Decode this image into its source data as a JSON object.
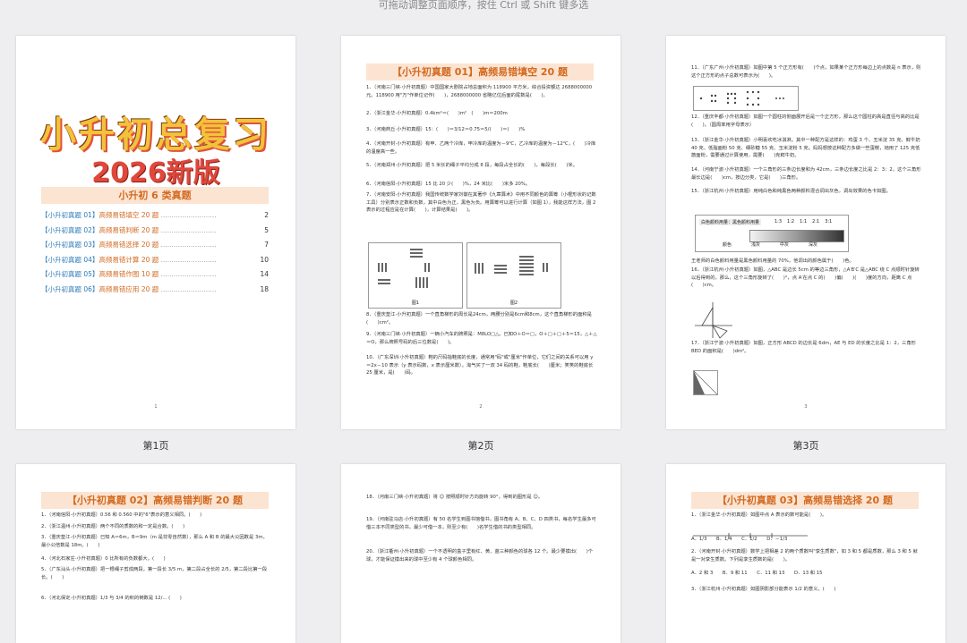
{
  "hint_text": "可拖动调整页面顺序，按住 Ctrl 或 Shift 键多选",
  "cover": {
    "title_line1": "小升初总复习",
    "title_line2": "2026新版",
    "subtitle": "小升初 6 类真题",
    "toc": [
      {
        "tag": "【小升初真题 01】",
        "title": "高频易错填空 20 题",
        "page": "2"
      },
      {
        "tag": "【小升初真题 02】",
        "title": "高频易错判断 20 题",
        "page": "5"
      },
      {
        "tag": "【小升初真题 03】",
        "title": "高频易错选择 20 题",
        "page": "7"
      },
      {
        "tag": "【小升初真题 04】",
        "title": "高频易错计算 20 题",
        "page": "10"
      },
      {
        "tag": "【小升初真题 05】",
        "title": "高频易错作图 10 题",
        "page": "14"
      },
      {
        "tag": "【小升初真题 06】",
        "title": "高频易错应用 20 题",
        "page": "18"
      }
    ],
    "page_number": "1"
  },
  "page_labels": [
    "第1页",
    "第2页",
    "第3页"
  ],
  "page2": {
    "header": "【小升初真题 01】高频易错填空 20 题",
    "questions": [
      "1．（河南三门峡·小升初真题）中国国家大剧院占地总面积为 118900 平方米，综合投资额达 2688000000 元。118900 用\"万\"作单位记作(　　)，2688000000 省略亿位后面的尾数是(　　)。",
      "2．（浙江金华·小升初真题）0.4km²＝(　　)m²　(　　)m＝200m",
      "3．（河南商丘·小升初真题）15：(　　)＝3/12＝0.75＝5/(　　)＝(　　)%",
      "4．（河南开封·小升初真题）有甲、乙两个冷库，甲冷库的温度为－9℃，乙冷库的温度为－12℃，(　　)冷库的温度高一些。",
      "5．（河南郑州·小升初真题）把 5 米长的绳子平均分成 8 段，每段占全长的(　　)，每段长(　　)米。",
      "6．（河南信阳·小升初真题）15 比 20 少(　　)%，24 米比(　　)米多 20%。",
      "7．（河南安阳·小升初真题）我国传统数学家刘徽在其著作《九章算术》中用不同颜色的算筹（小棍形状的记数工具）分别表示正数和负数，其中白色为正，黑色为负。用算筹可以进行计算（如图 1），我能这样方法，图 2 表示的过程应是在计算(　　)，计算结果是(　　)。",
      "8．（重庆垫江·小升初真题）一个直角梯形的周长是24cm，两腰分别是6cm和8cm，这个直角梯形的面积是(　　)cm²。",
      "9．（河南三门峡·小升初真题）一辆小汽车的牌照是：M8LO□△。已知O＋O＝□，O＋□＋□＋5＝15，△＋△＝O，那么牌照号码的后三位数是(　　)。",
      "10．（广东深圳·小升初真题）鞋的尺码指鞋底的长度，通常用\"码\"或\"厘米\"作单位，它们之间的关系可以用 y＝2x－10 表示（y 表示码数，x 表示厘米数）。淘气买了一双 34 码的鞋，鞋底长(　　)厘米；笑笑的鞋底长 25 厘米，是(　　)码。"
    ],
    "fig_labels": [
      "图1",
      "图2"
    ],
    "page_number": "2"
  },
  "page3": {
    "questions": [
      "11．（广东广州·小升初真题）如图中第 5 个正方形有(　　)个点，如果某个正方形每边上的点数是 n 表示，则这个正方形的点子总数可表示为(　　)。",
      "12．（重庆丰都·小升初真题）如图一个圆柱的侧面展开后是一个正方形，那么这个圆柱的高是直径与高的比是(　　)。（圆周率用字母表示）",
      "13．（浙江金华·小升初真题）小明喜欢吃冰淇淋。其中一种配方是这样的：鸡蛋 3 个、玉米淀 35 克、鲜牛奶 40 克、低脂面粉 50 克、细砂糖 55 克、玉米淀粉 5 克。妈妈想按这种配方多做一些蛋糕，她用了 125 克低筋面粉，需要通过计算使用，需要(　　)克鲜牛奶。",
      "14．（河南宁波·小升初真题）一个三角形的三条边长度和为 42cm，三条边长度之比是 2：3：2，这个三角形最长边是(　　)cm，按边分类，它是(　　)三角形。",
      "15．（浙江杭州·小升初真题）用纯白色和纯黑色两种颜料混合调出灰色，调出效果的色卡如图。",
      "王老师的白色颜料用量是黑色颜料用量的 70%，他调出的颜色属于(　　)色。",
      "16．（浙江杭州·小升初真题）如图，△ABC 是边长 5cm 的等边三角形，△A′B′C 是△ABC 绕 C 点顺时针旋转以后得到的，那么，这个三角形旋转了(　　)°，点 A′在点 C 的(　　)偏(　　)(　　)度的方向，距离 C 点(　　)cm。",
      "17．（浙江宁波·小升初真题）如图，正方形 ABCD 的边长是 6dm，AE 与 ED 的长度之比是 1：2，三角形 BED 的面积是(　　)dm²。"
    ],
    "color_card": {
      "label_left": "白色颜料用量：黑色颜料用量",
      "ratios": [
        "1:3",
        "1:2",
        "1:1",
        "2:1",
        "3:1"
      ],
      "color_names": [
        "颜色",
        "浅灰",
        "中灰",
        "深灰"
      ]
    },
    "page_number": "3"
  },
  "page4": {
    "header": "【小升初真题 02】高频易错判断 20 题",
    "questions": [
      "1．（河南信阳·小升初真题）0.56 和 0.560 中的\"6\"表示的意义相同。(　　)",
      "2．（浙江温州·小升初真题）两个不同的质数的和一定是合数。(　　)",
      "3．（重庆垫江·小升初真题）已知 A＝6m，B＝9m（m 是非零自然数），那么 A 和 B 的最大公因数是 3m，最小公倍数是 18m。(　　)",
      "4．（河北石家庄·小升初真题）0 比所有的负数都大。(　　)",
      "5．（广东汕头·小升初真题）把一根绳子剪成两段，第一段长 3/5 m，第二段占全长的 2/5，第二段比第一段长。(　　)",
      "6．（河北保定·小升初真题）1/3 与 3/4 的积的倒数是 12/... (　　)"
    ]
  },
  "page5": {
    "questions": [
      "18．（河南三门峡·小升初真题）将 ☺ 按照顺时针方向旋转 90°，得到的图形是 ☺。",
      "19．（河南驻马店·小升初真题）有 50 名学生到图书馆借书，图书角有 A、B、C、D 四类书，每名学生最多可借三本不同类型的书，最少可借一本，则至少有(　　)名学生借的书的类型相同。",
      "20．（浙江衢州·小升初真题）一个不透明的盒子里有红、黄、蓝三种颜色的球各 12 个。最少要摸出(　　)个球，才能保证摸出来的球中至少有 4 个球颜色相同。"
    ]
  },
  "page6": {
    "header": "【小升初真题 03】高频易错选择 20 题",
    "questions": [
      "1．（浙江金华·小升初真题）如图中点 A 表示的数可能是(　　)。",
      "A．1/3　　B．1/4　　C．1/2　　D．－1/3",
      "2．（河南开封·小升初真题）数学上把相差 2 的两个质数叫\"孪生质数\"，如 3 和 5 都是质数，那么 3 和 5 就是一对孪生质数。下列是孪生质数的是(　　)。",
      "A．2 和 3　　B．9 和 11　　C．11 和 13　　D．13 和 15",
      "3．（浙江杭州·小升初真题）如图阴影部分能表示 1/2 的意义。(　　)"
    ]
  }
}
